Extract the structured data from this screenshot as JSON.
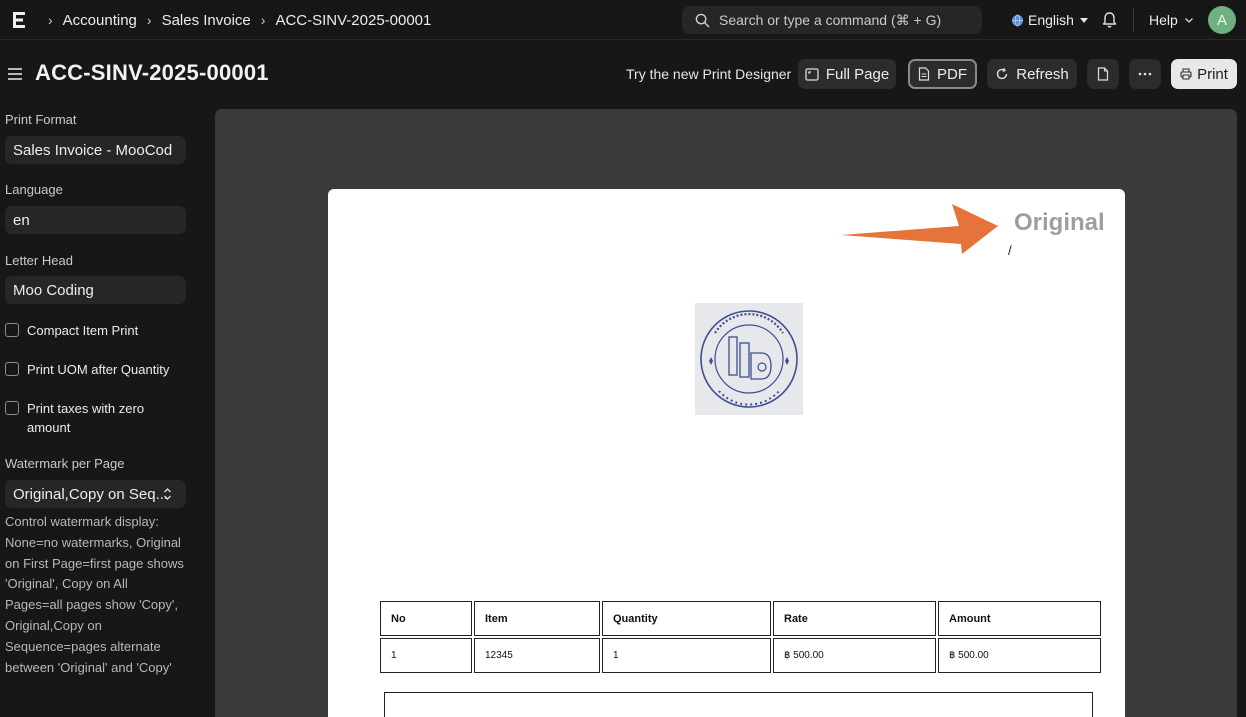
{
  "navbar": {
    "breadcrumbs": [
      "Accounting",
      "Sales Invoice",
      "ACC-SINV-2025-00001"
    ],
    "search_placeholder": "Search or type a command (⌘ + G)",
    "language": "English",
    "help": "Help",
    "avatar_initial": "A"
  },
  "header": {
    "title": "ACC-SINV-2025-00001",
    "try_designer": "Try the new Print Designer",
    "full_page": "Full Page",
    "pdf": "PDF",
    "refresh": "Refresh",
    "print": "Print"
  },
  "sidebar": {
    "print_format_label": "Print Format",
    "print_format_value": "Sales Invoice - MooCod",
    "language_label": "Language",
    "language_value": "en",
    "letter_head_label": "Letter Head",
    "letter_head_value": "Moo Coding",
    "compact_item_print": "Compact Item Print",
    "print_uom": "Print UOM after Quantity",
    "print_taxes": "Print taxes with zero amount",
    "watermark_label": "Watermark per Page",
    "watermark_value": "Original,Copy on Seq...",
    "watermark_help": "Control watermark display: None=no watermarks, Original on First Page=first page shows 'Original', Copy on All Pages=all pages show 'Copy', Original,Copy on Sequence=pages alternate between 'Original' and 'Copy'"
  },
  "preview": {
    "watermark": "Original",
    "slash": "/",
    "table": {
      "headers": [
        "No",
        "Item",
        "Quantity",
        "Rate",
        "Amount"
      ],
      "rows": [
        [
          "1",
          "12345",
          "1",
          "฿ 500.00",
          "฿ 500.00"
        ]
      ]
    }
  },
  "colors": {
    "accent_arrow": "#e5733a",
    "avatar": "#6fb07e",
    "stamp_ink": "#3d4f8f"
  }
}
